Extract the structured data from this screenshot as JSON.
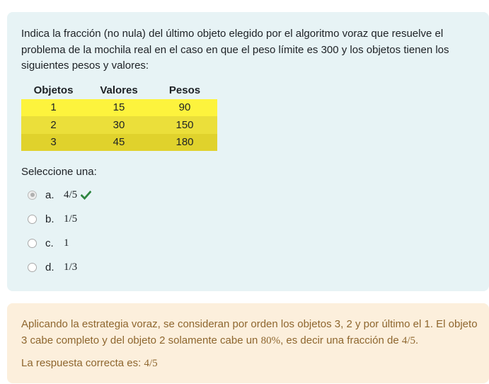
{
  "question": {
    "text": "Indica la fracción (no nula) del último objeto elegido por el algoritmo voraz que resuelve el problema de la mochila real en el caso en que el peso límite es 300 y los objetos tienen los siguientes pesos y valores:",
    "table": {
      "headers": [
        "Objetos",
        "Valores",
        "Pesos"
      ],
      "rows": [
        [
          "1",
          "15",
          "90"
        ],
        [
          "2",
          "30",
          "150"
        ],
        [
          "3",
          "45",
          "180"
        ]
      ],
      "row_colors": [
        "#fdf33d",
        "#ebdf3a",
        "#e0d22c"
      ]
    },
    "prompt": "Seleccione una:",
    "options": [
      {
        "letter": "a.",
        "value": "4/5",
        "selected": true,
        "correct": true
      },
      {
        "letter": "b.",
        "value": "1/5",
        "selected": false
      },
      {
        "letter": "c.",
        "value": "1",
        "selected": false
      },
      {
        "letter": "d.",
        "value": "1/3",
        "selected": false
      }
    ]
  },
  "feedback": {
    "part1": "Aplicando la estrategia voraz, se consideran por orden los objetos 3, 2 y por último el 1. El objeto 3 cabe completo y del objeto 2 solamente cabe un ",
    "percent": "80%",
    "part2": ", es decir una fracción de ",
    "fraction": "4/5",
    "part3": ".",
    "answer_label": "La respuesta correcta es: ",
    "answer_value": "4/5"
  },
  "colors": {
    "question_bg": "#e7f3f5",
    "feedback_bg": "#fcefdc",
    "feedback_text": "#8e662e",
    "correct_check": "#2e8540"
  },
  "icons": {
    "correct": "check-icon"
  }
}
